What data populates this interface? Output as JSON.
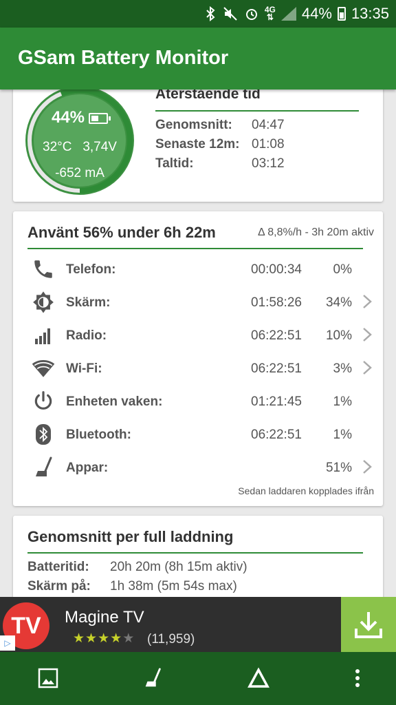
{
  "status_bar": {
    "battery_percent": "44%",
    "time": "13:35",
    "network": "4G",
    "icons": [
      "bluetooth-icon",
      "mute-icon",
      "alarm-icon",
      "4g-icon",
      "signal-icon",
      "battery-icon"
    ]
  },
  "app_bar": {
    "title": "GSam Battery Monitor"
  },
  "battery_card": {
    "gauge": {
      "percent_label": "44%",
      "level": 0.44,
      "temperature": "32°C",
      "voltage": "3,74V",
      "current": "-652 mA"
    },
    "remaining": {
      "title": "Återstående tid",
      "rows": [
        {
          "label": "Genomsnitt:",
          "value": "04:47"
        },
        {
          "label": "Senaste 12m:",
          "value": "01:08"
        },
        {
          "label": "Taltid:",
          "value": "03:12"
        }
      ]
    }
  },
  "usage_card": {
    "title": "Använt 56% under 6h 22m",
    "delta": "Δ 8,8%/h - 3h 20m aktiv",
    "rows": [
      {
        "icon": "phone-icon",
        "label": "Telefon:",
        "time": "00:00:34",
        "percent": "0%",
        "has_chevron": false
      },
      {
        "icon": "brightness-icon",
        "label": "Skärm:",
        "time": "01:58:26",
        "percent": "34%",
        "has_chevron": true
      },
      {
        "icon": "signal-bars-icon",
        "label": "Radio:",
        "time": "06:22:51",
        "percent": "10%",
        "has_chevron": true
      },
      {
        "icon": "wifi-icon",
        "label": "Wi-Fi:",
        "time": "06:22:51",
        "percent": "3%",
        "has_chevron": true
      },
      {
        "icon": "power-icon",
        "label": "Enheten vaken:",
        "time": "01:21:45",
        "percent": "1%",
        "has_chevron": false
      },
      {
        "icon": "bluetooth-icon",
        "label": "Bluetooth:",
        "time": "06:22:51",
        "percent": "1%",
        "has_chevron": false
      },
      {
        "icon": "apps-broom-icon",
        "label": "Appar:",
        "time": "",
        "percent": "51%",
        "has_chevron": true
      }
    ],
    "footnote": "Sedan laddaren kopplades ifrån"
  },
  "average_card": {
    "title": "Genomsnitt per full laddning",
    "rows": [
      {
        "label": "Batteritid:",
        "value": "20h 20m (8h 15m aktiv)"
      },
      {
        "label": "Skärm på:",
        "value": "1h 38m (5m 54s max)"
      }
    ]
  },
  "ad": {
    "logo_text": "TV",
    "name": "Magine TV",
    "rating": 3.5,
    "rating_count": "(11,959)",
    "download_icon": "download-icon"
  },
  "bottom_bar": {
    "buttons": [
      "image-icon",
      "broom-icon",
      "triangle-icon",
      "more-vert-icon"
    ]
  },
  "colors": {
    "status_bar": "#1b5e20",
    "app_bar": "#2e8b36",
    "accent_line": "#2e8b36",
    "gauge_fill": "#57a65c",
    "ad_download": "#8bc34a",
    "ad_logo": "#e53935"
  }
}
